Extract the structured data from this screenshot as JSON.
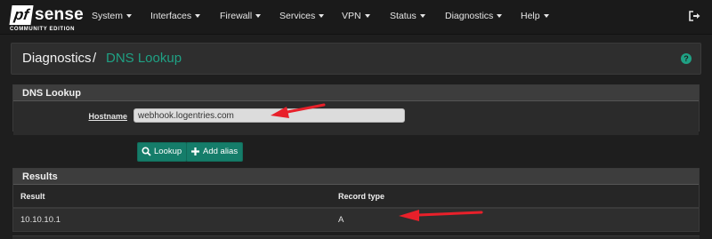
{
  "brand": {
    "logo_pf": "pf",
    "logo_sense": "sense",
    "edition": "COMMUNITY EDITION"
  },
  "nav": {
    "items": [
      {
        "label": "System"
      },
      {
        "label": "Interfaces"
      },
      {
        "label": "Firewall"
      },
      {
        "label": "Services"
      },
      {
        "label": "VPN"
      },
      {
        "label": "Status"
      },
      {
        "label": "Diagnostics"
      },
      {
        "label": "Help"
      }
    ],
    "logout_icon": "sign-out-icon"
  },
  "breadcrumb": {
    "parent": "Diagnostics",
    "separator": "/",
    "current": "DNS Lookup",
    "help_icon": "question-circle-icon",
    "help_glyph": "?"
  },
  "lookup_panel": {
    "title": "DNS Lookup",
    "hostname_label": "Hostname",
    "hostname_value": "webhook.logentries.com",
    "lookup_button": "Lookup",
    "add_alias_button": "Add alias"
  },
  "results_panel": {
    "title": "Results",
    "columns": [
      "Result",
      "Record type"
    ],
    "rows": [
      {
        "result": "10.10.10.1",
        "record_type": "A"
      }
    ]
  },
  "colors": {
    "accent": "#1fa184",
    "button": "#157d6a",
    "annotation_arrow": "#e8202a",
    "background": "#1e1e1e"
  }
}
